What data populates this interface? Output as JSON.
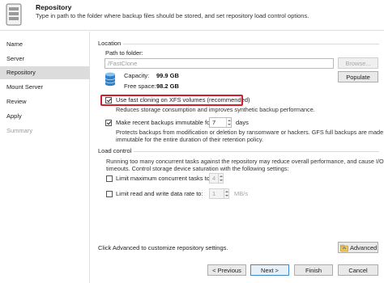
{
  "header": {
    "title": "Repository",
    "subtitle": "Type in path to the folder where backup files should be stored, and set repository load control options."
  },
  "steps": [
    {
      "label": "Name",
      "state": "normal"
    },
    {
      "label": "Server",
      "state": "normal"
    },
    {
      "label": "Repository",
      "state": "active"
    },
    {
      "label": "Mount Server",
      "state": "normal"
    },
    {
      "label": "Review",
      "state": "normal"
    },
    {
      "label": "Apply",
      "state": "normal"
    },
    {
      "label": "Summary",
      "state": "disabled"
    }
  ],
  "location": {
    "section_label": "Location",
    "path_label": "Path to folder:",
    "path_value": "/FastClone",
    "browse_label": "Browse...",
    "capacity_label": "Capacity:",
    "capacity_value": "99.9 GB",
    "free_label": "Free space:",
    "free_value": "98.2 GB",
    "populate_label": "Populate",
    "fast_clone": {
      "checked": true,
      "label": "Use fast cloning on XFS volumes (recommended)",
      "description": "Reduces storage consumption and improves synthetic backup performance."
    },
    "immutable": {
      "checked": true,
      "label": "Make recent backups immutable for:",
      "days_value": "7",
      "days_unit": "days",
      "description_line1": "Protects backups from modification or deletion by ransomware or hackers. GFS full backups are made",
      "description_line2": "immutable for the entire duration of their retention policy."
    }
  },
  "load_control": {
    "section_label": "Load control",
    "description_line1": "Running too many concurrent tasks against the repository may reduce overall performance, and cause I/O",
    "description_line2": "timeouts. Control storage device saturation with the following settings:",
    "limit_tasks": {
      "checked": false,
      "label": "Limit maximum concurrent tasks to:",
      "value": "4"
    },
    "limit_rate": {
      "checked": false,
      "label": "Limit read and write data rate to:",
      "value": "1",
      "unit": "MB/s"
    }
  },
  "advanced": {
    "note": "Click Advanced to customize repository settings.",
    "button_label": "Advanced"
  },
  "footer": {
    "previous_label": "< Previous",
    "next_label": "Next >",
    "finish_label": "Finish",
    "cancel_label": "Cancel"
  },
  "colors": {
    "highlight": "#d01f2a",
    "active_step": "#dcdcdc",
    "primary_border": "#3d88c9"
  }
}
